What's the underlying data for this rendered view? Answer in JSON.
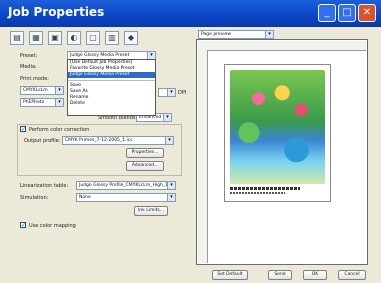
{
  "window": {
    "title": "Job Properties"
  },
  "titlebar": {
    "minimize": "_",
    "maximize": "□",
    "close": "✕"
  },
  "toolbar": {
    "icons": [
      "print-settings-icon",
      "layout-icon",
      "media-icon",
      "color-icon",
      "copy-icon",
      "save-icon",
      "info-icon"
    ]
  },
  "form": {
    "preset_label": "Preset:",
    "preset_value": "Judge Glossy Media Preset",
    "media_label": "Media:",
    "print_mode_label": "Print mode:",
    "print_mode_value": "CMYKLcLm",
    "ink_value": "PhEPhoto",
    "dpi_label": "DPI",
    "smooth_blends_label": "Smooth blends:",
    "smooth_blends_value": "Enhanced",
    "color_correction_label": "Perform color correction",
    "output_profile_label": "Output profile:",
    "output_profile_value": "CMYK Primes_7-12-2005_1.icc",
    "properties_button": "Properties...",
    "advanced_button": "Advanced...",
    "linearization_label": "Linearization table:",
    "linearization_value": "Judge Glossy Profile_CMYKLcLm_High_1",
    "simulation_label": "Simulation:",
    "simulation_value": "None",
    "ink_limits_button": "Ink Limits...",
    "color_mapping_label": "Use color mapping"
  },
  "preset_menu": {
    "items": [
      "[Use Default Job Properties]",
      "Favorite Glossy Media Preset",
      "Judge Glossy Media Preset"
    ],
    "actions": [
      "Save",
      "Save As",
      "Rename",
      "Delete"
    ],
    "highlighted_index": 2
  },
  "preview": {
    "view_select": "Page preview"
  },
  "footer": {
    "set_default": "Set Default",
    "send": "Send",
    "ok": "OK",
    "cancel": "Cancel"
  }
}
